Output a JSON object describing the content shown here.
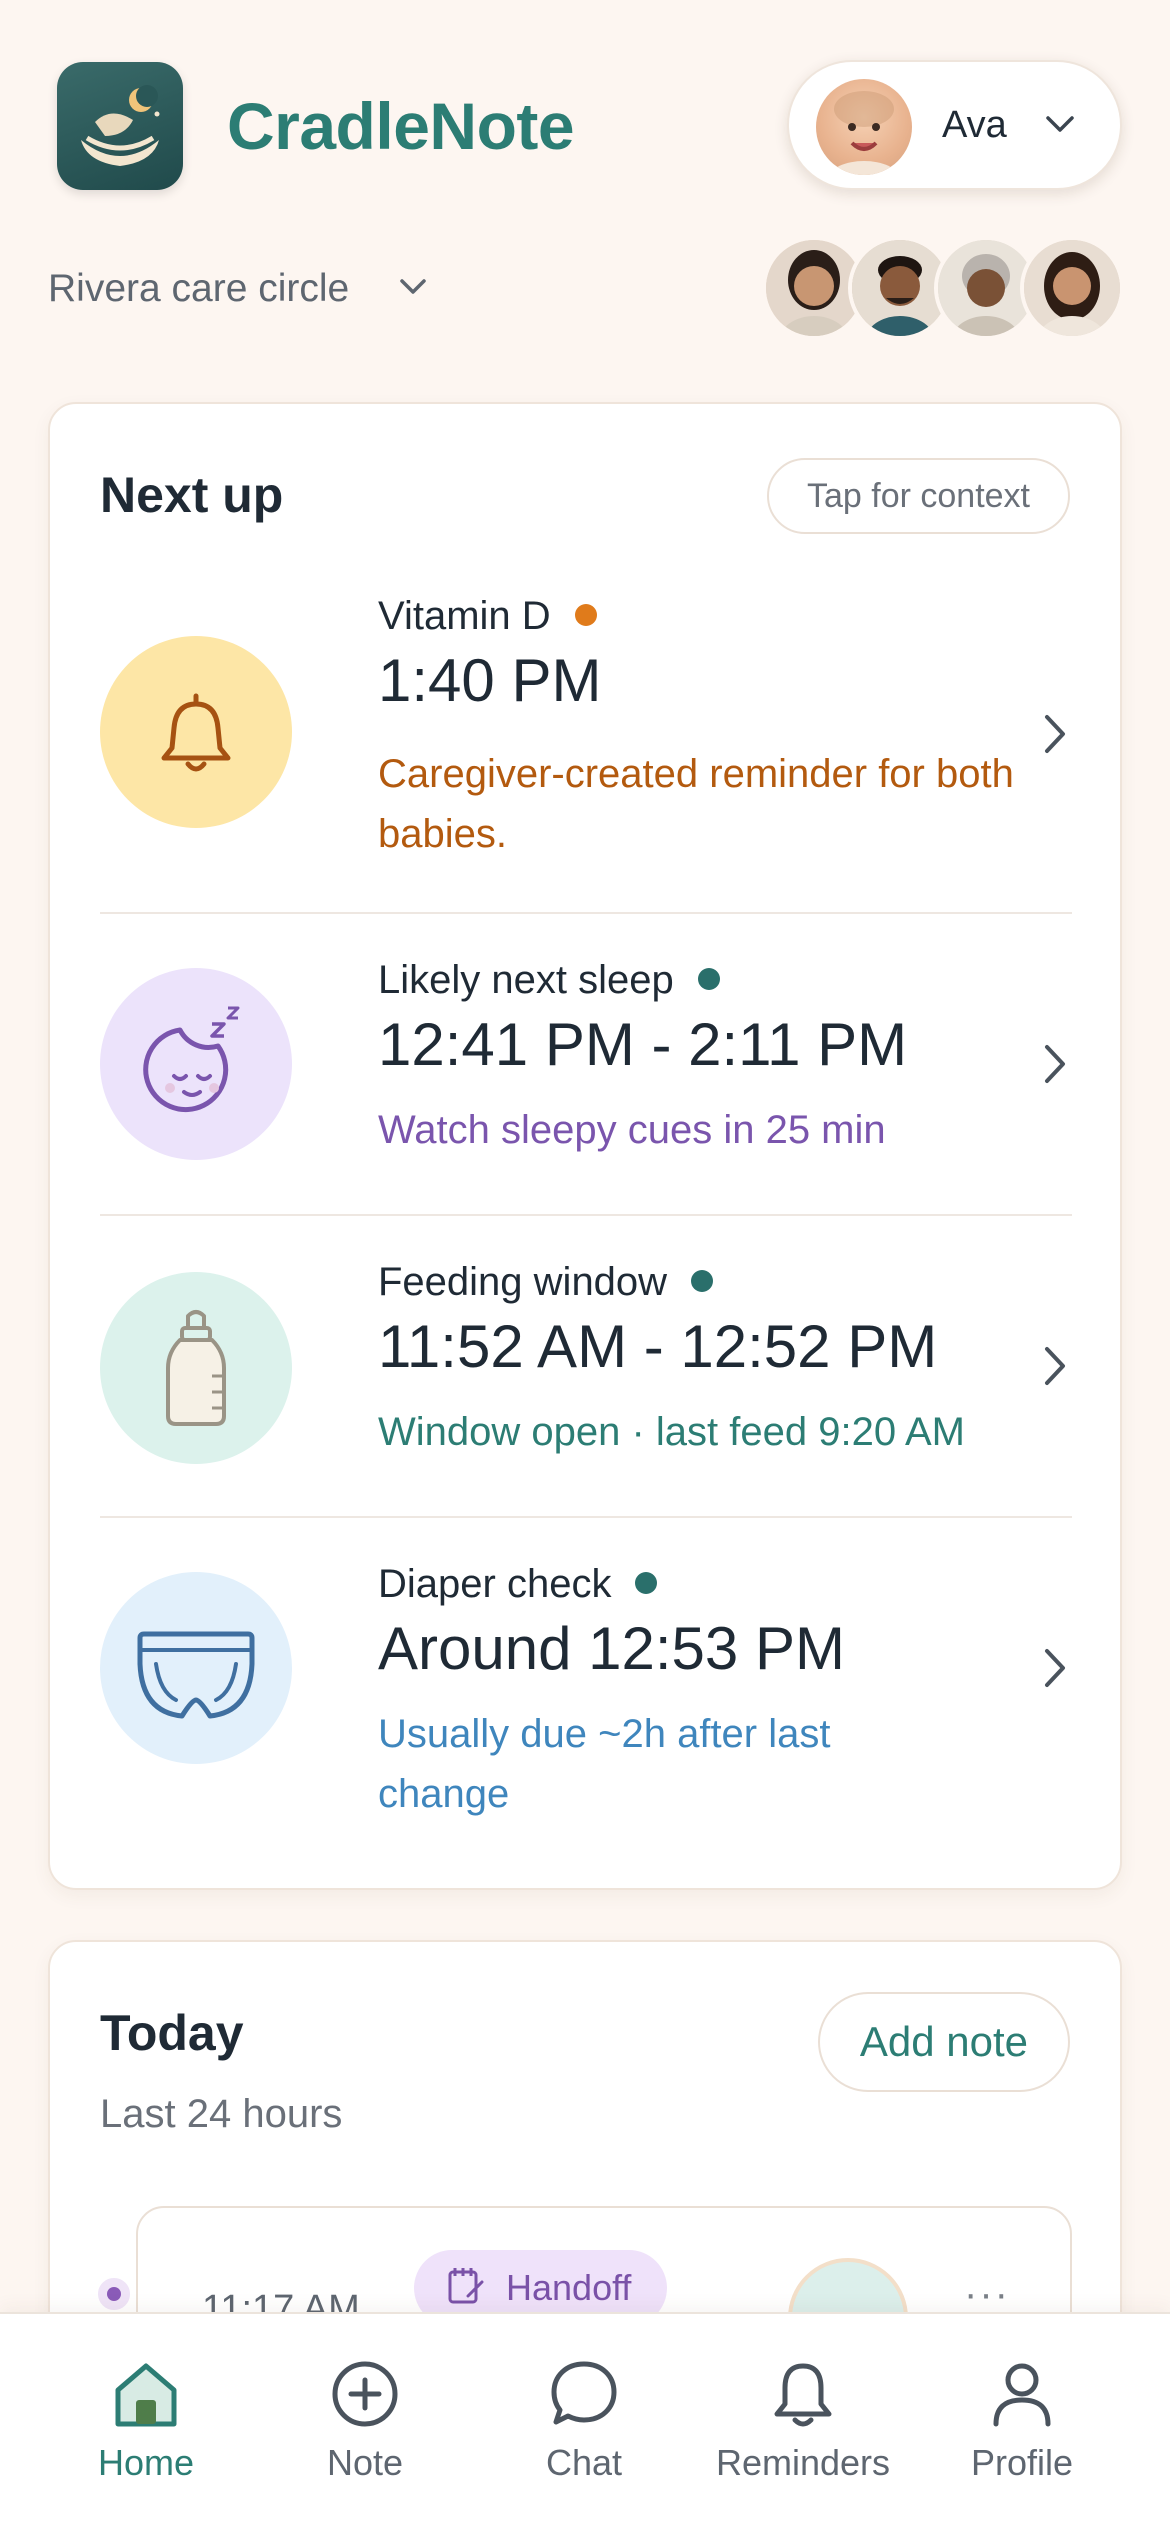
{
  "app": {
    "title": "CradleNote"
  },
  "baby_switcher": {
    "name": "Ava"
  },
  "care_circle": {
    "label": "Rivera care circle"
  },
  "next_up": {
    "title": "Next up",
    "context_button": "Tap for context",
    "items": [
      {
        "label": "Vitamin D",
        "time": "1:40 PM",
        "note": "Caregiver-created reminder for both babies.",
        "icon": "bell-icon",
        "dot_color": "#e07b1b",
        "note_color": "#b35a0f",
        "icon_bg": "#fde6a6"
      },
      {
        "label": "Likely next sleep",
        "time": "12:41 PM - 2:11 PM",
        "note": "Watch sleepy cues in 25 min",
        "icon": "sleepy-moon-icon",
        "dot_color": "#2a6f6b",
        "note_color": "#7a55ad",
        "icon_bg": "#ece3fb"
      },
      {
        "label": "Feeding window",
        "time": "11:52 AM - 12:52 PM",
        "note": "Window open · last feed 9:20 AM",
        "icon": "bottle-icon",
        "dot_color": "#2a6f6b",
        "note_color": "#2c7d74",
        "icon_bg": "#dcf2ec"
      },
      {
        "label": "Diaper check",
        "time": "Around 12:53 PM",
        "note": "Usually due ~2h after last change",
        "icon": "diaper-icon",
        "dot_color": "#2a6f6b",
        "note_color": "#3f86bd",
        "icon_bg": "#e2f0fb"
      }
    ]
  },
  "today": {
    "title": "Today",
    "subtitle": "Last 24 hours",
    "add_note": "Add note",
    "entry": {
      "time": "11:17 AM",
      "tag": "Handoff",
      "more": "···"
    }
  },
  "tabbar": {
    "items": [
      {
        "label": "Home",
        "icon": "home-icon",
        "active": true
      },
      {
        "label": "Note",
        "icon": "plus-circle-icon",
        "active": false
      },
      {
        "label": "Chat",
        "icon": "chat-bubble-icon",
        "active": false
      },
      {
        "label": "Reminders",
        "icon": "bell-icon",
        "active": false
      },
      {
        "label": "Profile",
        "icon": "person-icon",
        "active": false
      }
    ]
  },
  "colors": {
    "accent": "#2c7d74",
    "background": "#fdf6f1"
  }
}
